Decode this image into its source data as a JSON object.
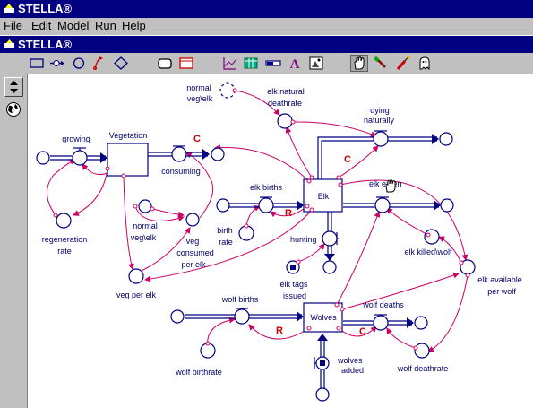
{
  "app": {
    "title": "STELLA®",
    "model_title": "STELLA®"
  },
  "menu": {
    "file": "File",
    "edit": "Edit",
    "model": "Model",
    "run": "Run",
    "help": "Help"
  },
  "toolbar": {
    "tools": [
      "stock-tool-icon",
      "flow-tool-icon",
      "converter-tool-icon",
      "connector-tool-icon",
      "decision-tool-icon",
      "button-tool-icon",
      "sector-tool-icon",
      "graph-tool-icon",
      "table-tool-icon",
      "numeric-display-tool-icon",
      "text-tool-icon",
      "graphics-frame-tool-icon",
      "hand-tool-icon",
      "paintbrush-tool-icon",
      "dynamite-tool-icon",
      "ghost-tool-icon"
    ],
    "selected": "hand-tool-icon"
  },
  "sidebar": {
    "tools": [
      "up-down-arrows-icon",
      "globe-icon"
    ]
  },
  "diagram": {
    "stocks": {
      "vegetation": "Vegetation",
      "elk": "Elk",
      "wolves": "Wolves"
    },
    "flows": {
      "growing": "growing",
      "consuming": "consuming",
      "elk_births": "elk births",
      "dying_naturally_1": "dying",
      "dying_naturally_2": "naturally",
      "elk_eaten": "elk eaten",
      "hunting": "hunting",
      "wolf_births": "wolf births",
      "wolf_deaths": "wolf deaths",
      "wolves_added_1": "wolves",
      "wolves_added_2": "added"
    },
    "converters": {
      "regeneration_rate_1": "regeneration",
      "regeneration_rate_2": "rate",
      "normal_veg_elk_1": "normal",
      "normal_veg_elk_2": "veg\\elk",
      "veg_consumed_per_elk_1": "veg",
      "veg_consumed_per_elk_2": "consumed",
      "veg_consumed_per_elk_3": "per elk",
      "veg_per_elk": "veg per elk",
      "ghost_normal_veg_elk_1": "normal",
      "ghost_normal_veg_elk_2": "veg\\elk",
      "elk_natural_deathrate_1": "elk natural",
      "elk_natural_deathrate_2": "deathrate",
      "birth_rate_1": "birth",
      "birth_rate_2": "rate",
      "elk_tags_issued_1": "elk tags",
      "elk_tags_issued_2": "issued",
      "elk_killed_wolf": "elk killed\\wolf",
      "elk_available_per_wolf_1": "elk available",
      "elk_available_per_wolf_2": "per wolf",
      "wolf_birthrate": "wolf birthrate",
      "wolf_deathrate": "wolf deathrate"
    },
    "loops": {
      "veg_consuming": "C",
      "elk_births": "R",
      "elk_dying": "C",
      "wolf_births": "R",
      "wolf_deaths": "C"
    },
    "colors": {
      "flow": "#000080",
      "connector": "#cc0066",
      "loop_label": "#cc0000",
      "stock_fill": "#ffffff"
    }
  }
}
